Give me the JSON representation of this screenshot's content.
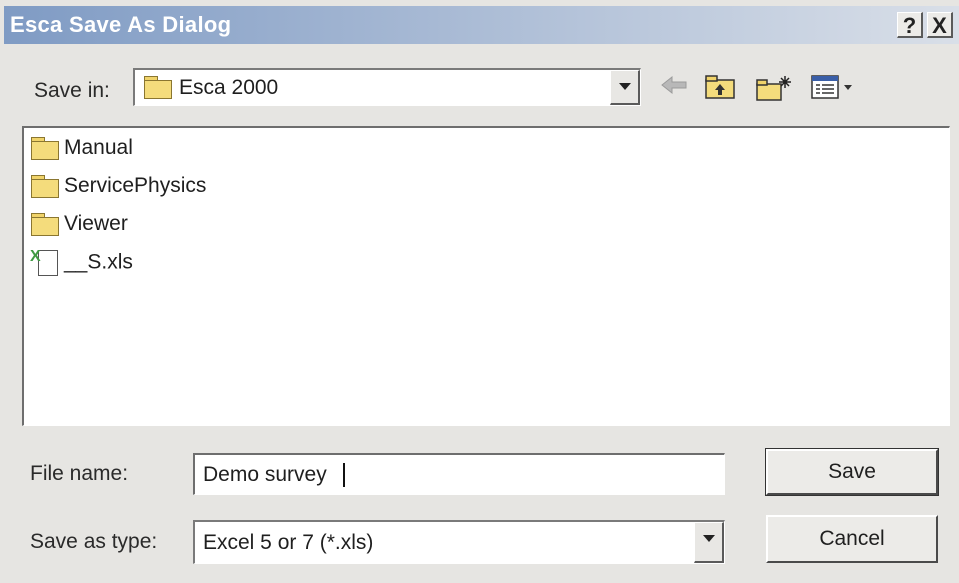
{
  "window": {
    "title": "Esca Save As Dialog",
    "help_button": "?",
    "close_button": "X"
  },
  "save_in": {
    "label": "Save in:",
    "value": "Esca 2000",
    "icon": "folder-icon"
  },
  "toolbar": {
    "back_icon": "back-arrow-icon",
    "up_icon": "up-folder-icon",
    "new_folder_icon": "new-folder-icon",
    "view_menu_icon": "view-menu-icon"
  },
  "files": [
    {
      "name": "Manual",
      "type": "folder"
    },
    {
      "name": "ServicePhysics",
      "type": "folder"
    },
    {
      "name": "Viewer",
      "type": "folder"
    },
    {
      "name": "__S.xls",
      "type": "excel"
    }
  ],
  "file_name": {
    "label": "File name:",
    "value": "Demo survey"
  },
  "save_as_type": {
    "label": "Save as type:",
    "value": "Excel 5 or 7 (*.xls)"
  },
  "buttons": {
    "save": "Save",
    "cancel": "Cancel"
  }
}
